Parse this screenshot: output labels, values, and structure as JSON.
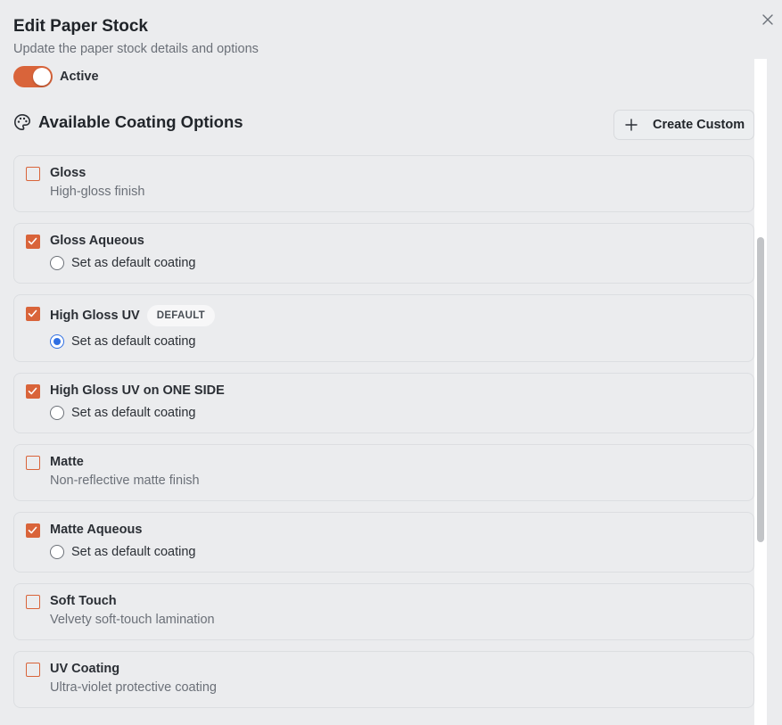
{
  "dialog": {
    "title": "Edit Paper Stock",
    "subtitle": "Update the paper stock details and options",
    "active_label": "Active",
    "active": true
  },
  "coating": {
    "section_title": "Available Coating Options",
    "create_label": "Create Custom",
    "default_badge": "DEFAULT",
    "set_default_label": "Set as default coating",
    "options": [
      {
        "name": "Gloss",
        "checked": false,
        "description": "High-gloss finish"
      },
      {
        "name": "Gloss Aqueous",
        "checked": true,
        "is_default": false
      },
      {
        "name": "High Gloss UV",
        "checked": true,
        "is_default": true
      },
      {
        "name": "High Gloss UV on ONE SIDE",
        "checked": true,
        "is_default": false
      },
      {
        "name": "Matte",
        "checked": false,
        "description": "Non-reflective matte finish"
      },
      {
        "name": "Matte Aqueous",
        "checked": true,
        "is_default": false
      },
      {
        "name": "Soft Touch",
        "checked": false,
        "description": "Velvety soft-touch lamination"
      },
      {
        "name": "UV Coating",
        "checked": false,
        "description": "Ultra-violet protective coating"
      }
    ]
  },
  "colors": {
    "accent": "#d9643a",
    "radio_selected": "#2f6fe3"
  }
}
